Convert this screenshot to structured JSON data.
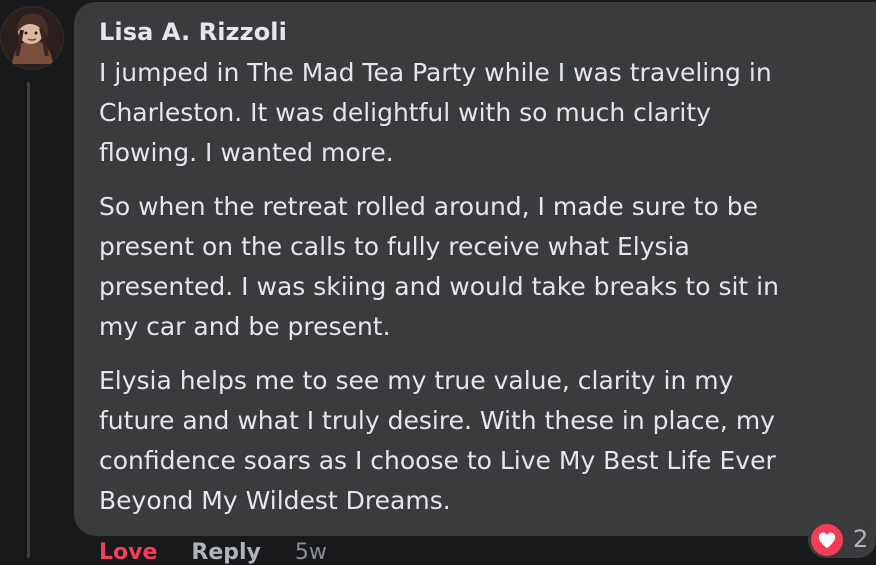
{
  "comment": {
    "author": "Lisa A. Rizzoli",
    "paragraphs": [
      [
        "I jumped in The Mad Tea Party while I was traveling in",
        "Charleston. It was delightful with so much clarity",
        "flowing. I wanted more."
      ],
      [
        "So when the retreat rolled around, I made sure to be",
        "present on the calls to fully receive what Elysia",
        "presented. I was skiing and would take breaks to sit in",
        "my car and be present."
      ],
      [
        "Elysia helps me to see my true value, clarity in my",
        "future and what I truly desire. With these in place, my",
        "confidence soars as I choose to Live My Best Life Ever",
        "Beyond My Wildest Dreams."
      ]
    ]
  },
  "actions": {
    "love": "Love",
    "reply": "Reply",
    "time": "5w"
  },
  "reactions": {
    "icon": "heart-icon",
    "count": "2"
  },
  "colors": {
    "background": "#18191a",
    "bubble": "#3a3b3c",
    "text": "#e4e6eb",
    "secondary": "#b0b3b8",
    "love": "#f33e58"
  }
}
